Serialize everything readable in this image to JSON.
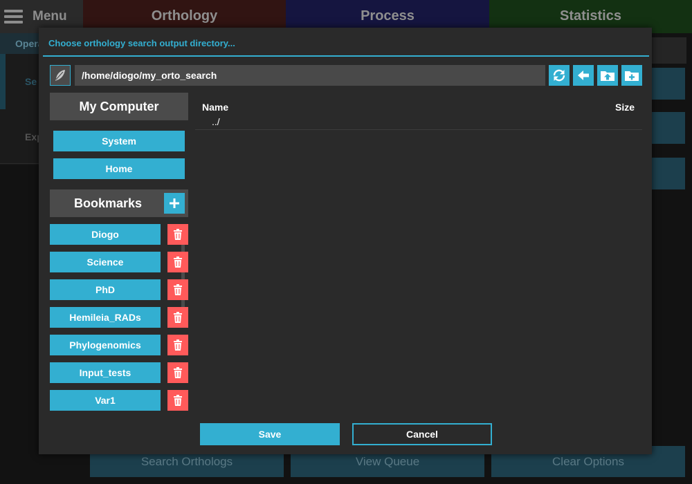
{
  "colors": {
    "accent": "#33afd1",
    "danger": "#ff5a5a",
    "dialog_bg": "#2a2a2a",
    "field_bg": "#494949"
  },
  "app": {
    "menu_label": "Menu",
    "tabs": [
      "Orthology",
      "Process",
      "Statistics"
    ],
    "left_panel": {
      "section_label": "Opera",
      "item_selected": "Se",
      "item_other": "Exp"
    },
    "bottom_buttons": [
      "Search Orthologs",
      "View Queue",
      "Clear Options"
    ]
  },
  "dialog": {
    "title": "Choose orthology search output directory...",
    "path": "/home/diogo/my_orto_search",
    "toolbar_icons": [
      "feather-icon",
      "refresh-icon",
      "back-arrow-icon",
      "folder-up-icon",
      "new-folder-icon"
    ],
    "my_computer": {
      "header": "My Computer",
      "places": [
        "System",
        "Home"
      ]
    },
    "bookmarks": {
      "header": "Bookmarks",
      "items": [
        "Diogo",
        "Science",
        "PhD",
        "Hemileia_RADs",
        "Phylogenomics",
        "Input_tests",
        "Var1"
      ]
    },
    "file_list": {
      "columns": [
        "Name",
        "Size"
      ],
      "rows": [
        "../"
      ]
    },
    "save_label": "Save",
    "cancel_label": "Cancel"
  }
}
